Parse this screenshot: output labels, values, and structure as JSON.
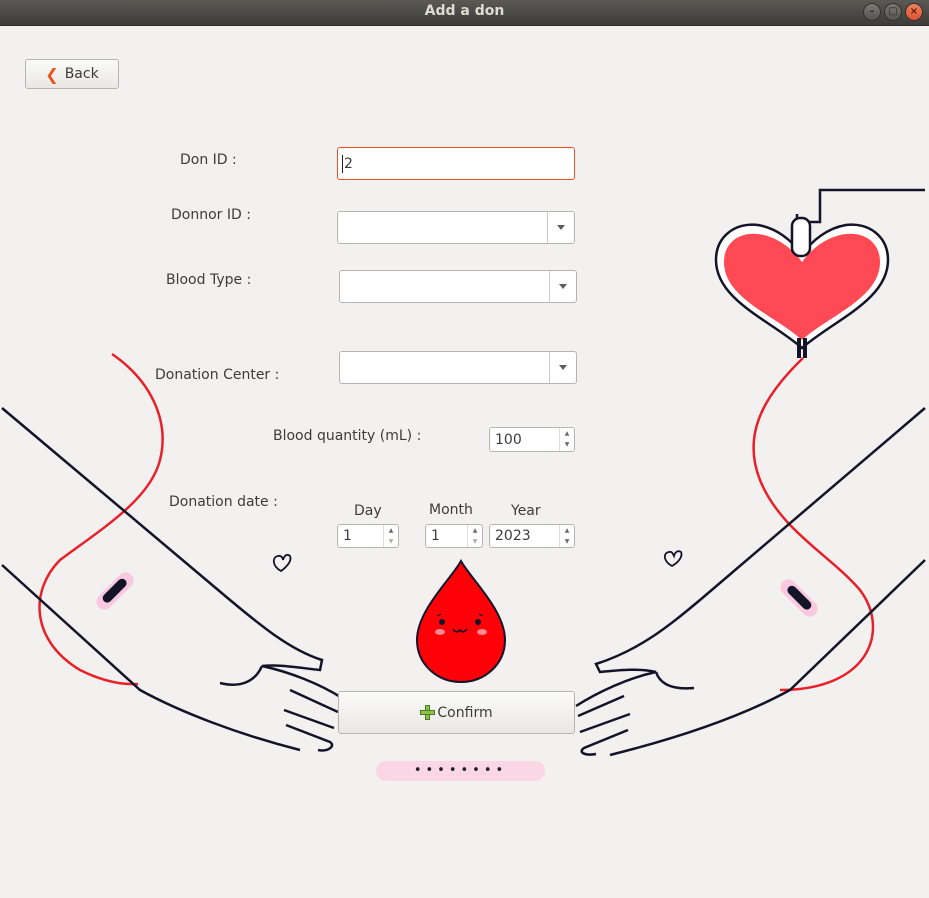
{
  "window": {
    "title": "Add a don",
    "minimize_icon": "minimize-icon",
    "maximize_icon": "maximize-icon",
    "close_icon": "close-icon"
  },
  "back_button": {
    "label": "Back",
    "icon": "chevron-left-icon"
  },
  "form": {
    "don_id": {
      "label": "Don ID :",
      "value": "2"
    },
    "donor_id": {
      "label": "Donnor ID :",
      "value": ""
    },
    "blood_type": {
      "label": "Blood Type :",
      "value": ""
    },
    "donation_center": {
      "label": "Donation Center :",
      "value": ""
    },
    "blood_quantity": {
      "label": "Blood quantity (mL) :",
      "value": "100"
    },
    "donation_date": {
      "label": "Donation date :",
      "day_label": "Day",
      "month_label": "Month",
      "year_label": "Year",
      "day": "1",
      "month": "1",
      "year": "2023"
    }
  },
  "confirm_button": {
    "label": "Confirm",
    "icon": "plus-icon"
  },
  "password_field": {
    "value": "••••••••"
  },
  "colors": {
    "blood_red": "#ff0009",
    "heart_red": "#ff4a55",
    "accent_orange": "#e95420",
    "pink": "#fbd7e6",
    "outline": "#141428"
  }
}
